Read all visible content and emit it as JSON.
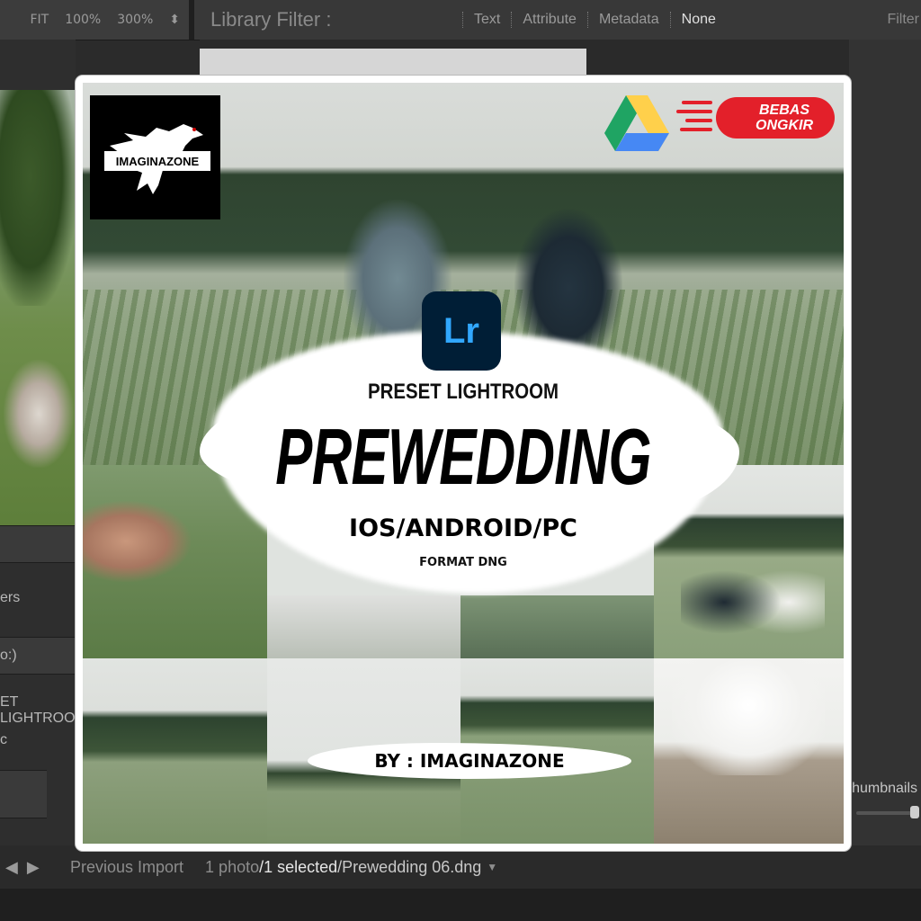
{
  "toolbar": {
    "fit": "FIT",
    "zoom1": "100%",
    "zoom2": "300%",
    "filter_title": "Library Filter :",
    "filter_options": [
      "Text",
      "Attribute",
      "Metadata",
      "None"
    ],
    "filter_right": "Filter"
  },
  "left_panel": {
    "label1": "ers",
    "label2": "o:)",
    "label3": "ET LIGHTROO",
    "label4": "c"
  },
  "right_panel": {
    "thumbnails_label": "Thumbnails"
  },
  "status_bar": {
    "prev": "Previous Import",
    "count": "1 photo",
    "selected": "/1 selected",
    "file": "/Prewedding 06.dng"
  },
  "card": {
    "brand": "IMAGINAZONE",
    "shipping_line1": "BEBAS",
    "shipping_line2": "ONGKIR",
    "app_icon": "Lr",
    "subtitle": "PRESET LIGHTROOM",
    "title": "PREWEDDING",
    "platforms": "IOS/ANDROID/PC",
    "format": "FORMAT DNG",
    "byline": "BY : IMAGINAZONE"
  },
  "icons": {
    "drive": "google-drive-icon",
    "lightroom": "lightroom-icon",
    "arrows": "nav-arrows-icon"
  },
  "colors": {
    "lr_bg": "#001e36",
    "lr_text": "#31a8ff",
    "ongkir_red": "#e3202a",
    "drive_green": "#1fa463",
    "drive_yellow": "#ffd04b",
    "drive_blue": "#4688f4"
  }
}
